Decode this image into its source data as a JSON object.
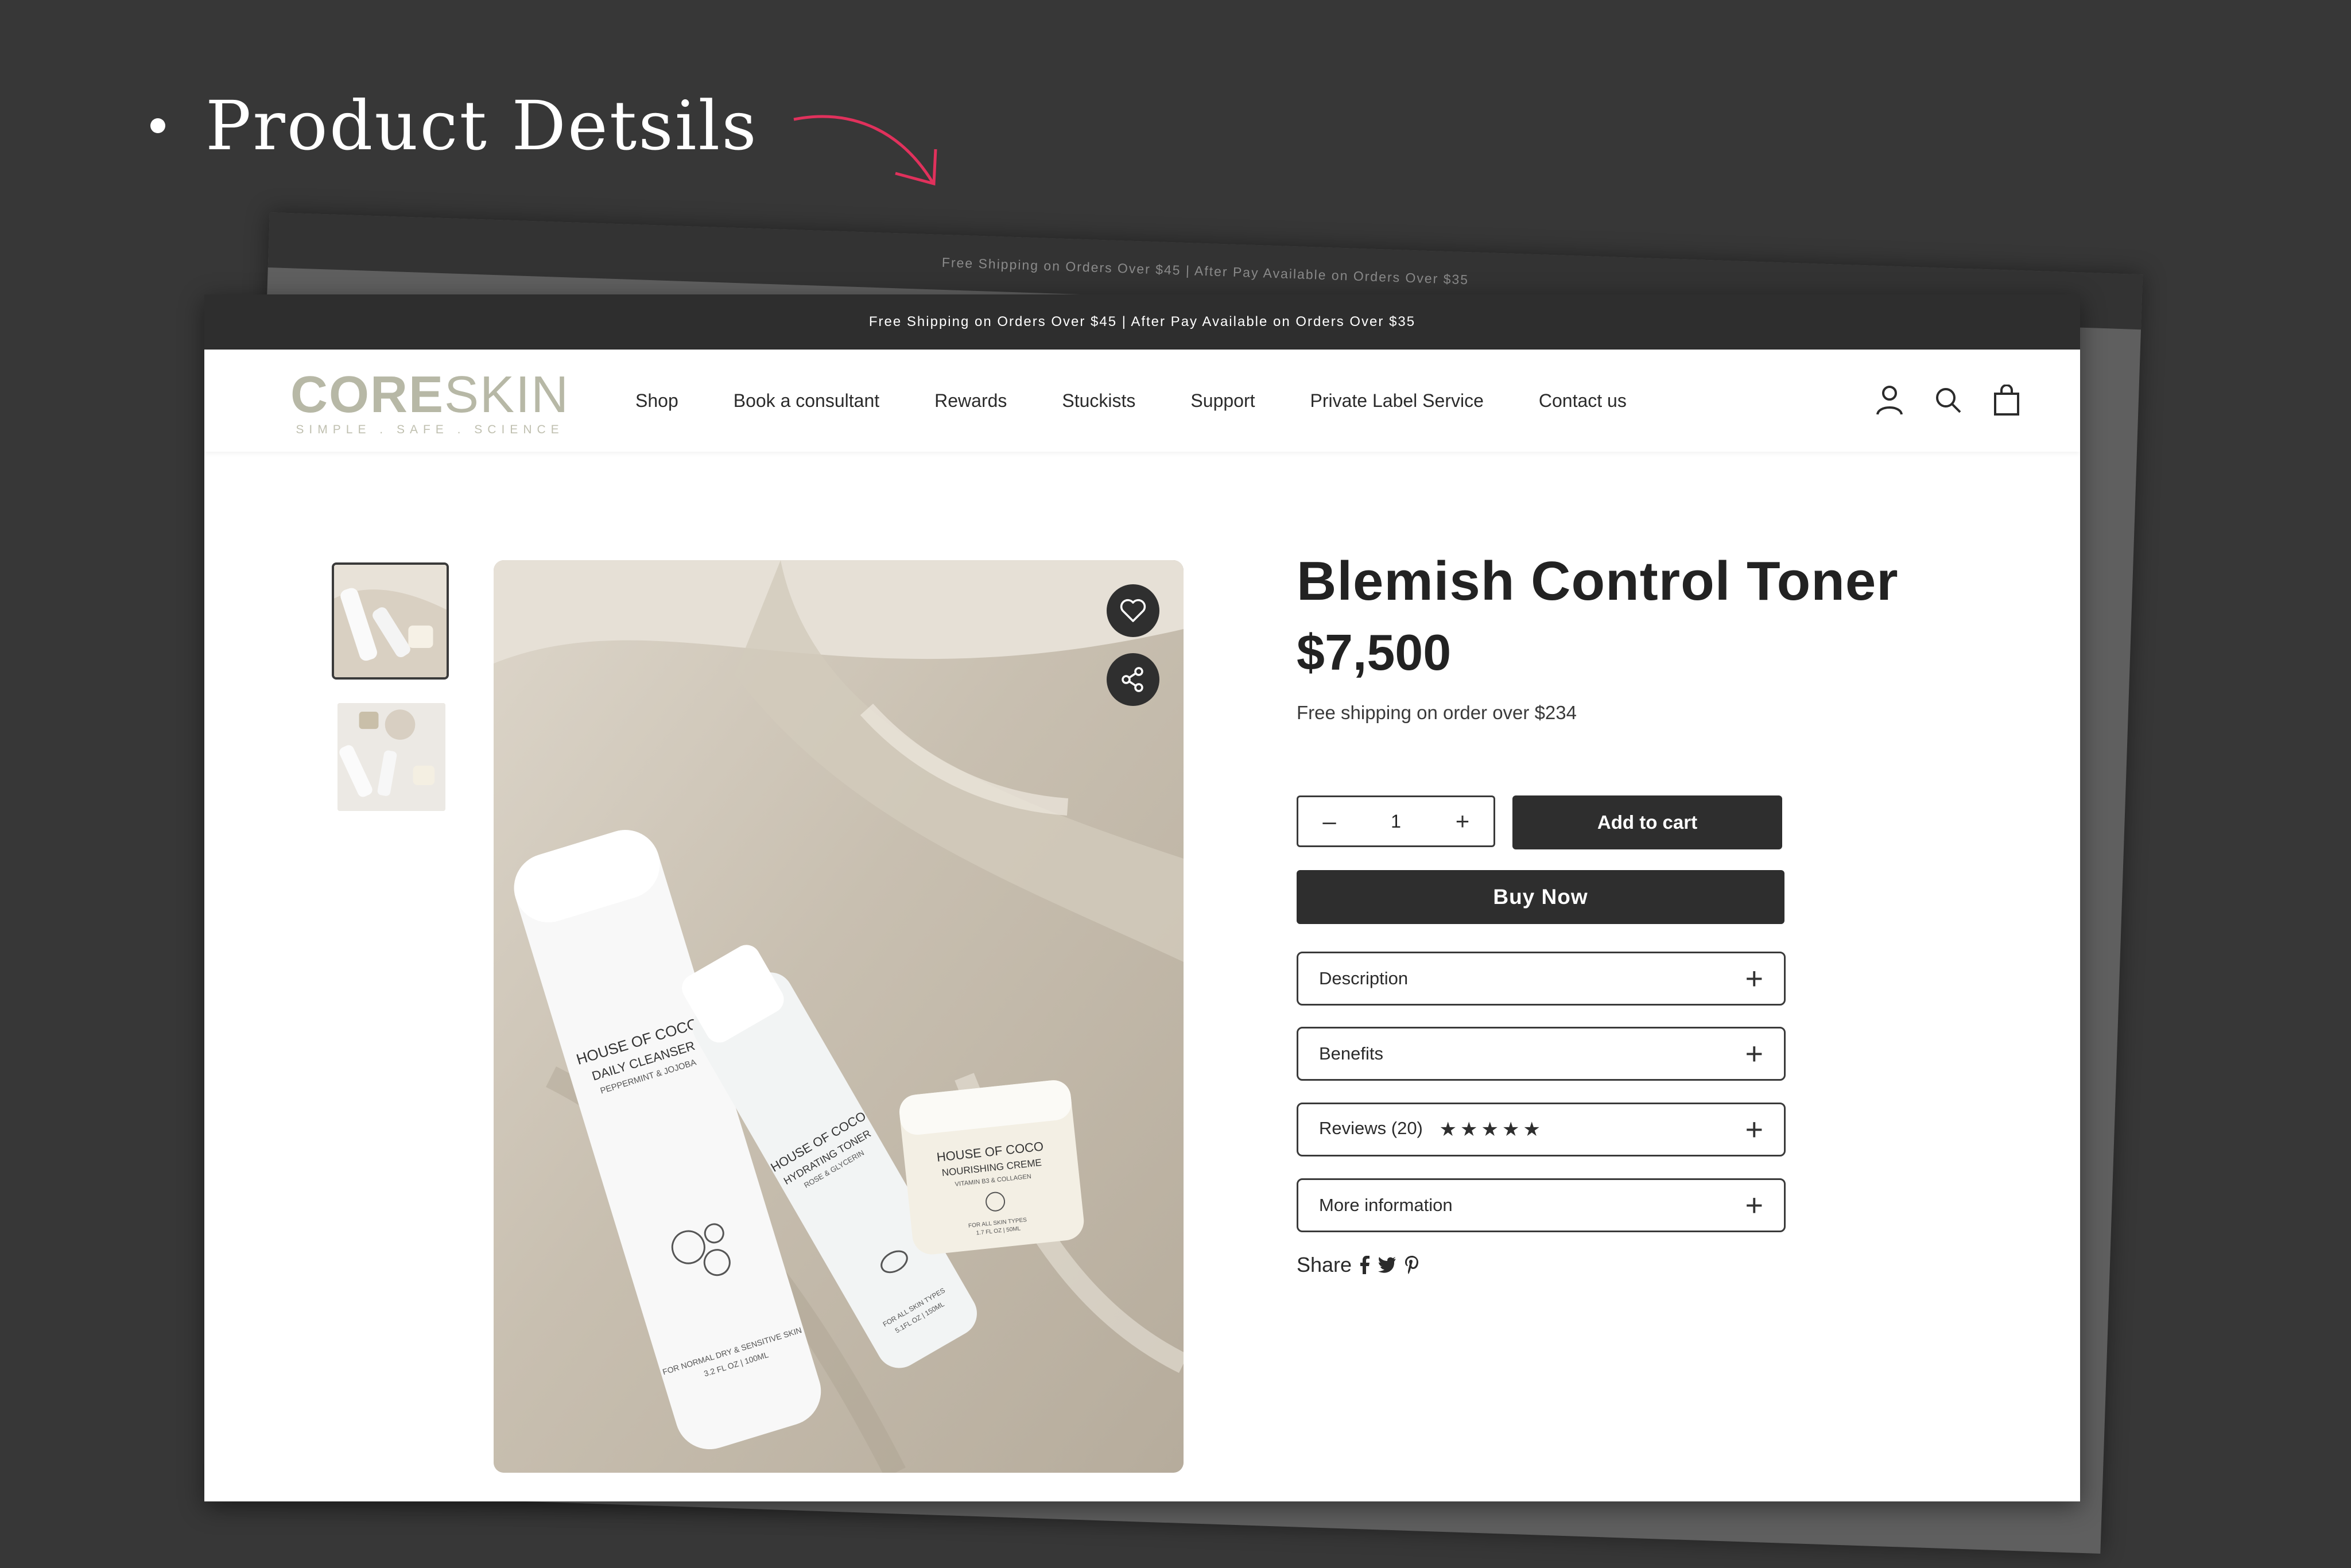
{
  "presentation": {
    "heading": "Product Detsils"
  },
  "back_page": {
    "announcement": "Free Shipping on Orders Over $45 | After Pay Available on Orders Over $35"
  },
  "announcement": "Free Shipping on Orders Over $45 | After Pay Available on Orders Over $35",
  "brand": {
    "logo_core": "CORE",
    "logo_skin": "SKIN",
    "tagline": "SIMPLE . SAFE . SCIENCE"
  },
  "nav": {
    "items": [
      "Shop",
      "Book a consultant",
      "Rewards",
      "Stuckists",
      "Support",
      "Private Label Service",
      "Contact us"
    ]
  },
  "header_icons": [
    "account-icon",
    "search-icon",
    "cart-bag-icon"
  ],
  "product": {
    "title": "Blemish Control Toner",
    "price": "$7,500",
    "shipping_note": "Free shipping on order over $234",
    "quantity": "1",
    "add_to_cart": "Add to cart",
    "buy_now": "Buy Now",
    "accordions": {
      "description": "Description",
      "benefits": "Benefits",
      "reviews": "Reviews (20)",
      "more_info": "More information"
    },
    "rating_stars": 5,
    "share_label": "Share",
    "share_icons": [
      "facebook-icon",
      "twitter-icon",
      "pinterest-icon"
    ]
  },
  "photo": {
    "products": [
      {
        "brand": "HOUSE OF COCO",
        "name": "DAILY CLEANSER",
        "sub": "PEPPERMINT & JOJOBA",
        "foot": "FOR NORMAL DRY & SENSITIVE SKIN",
        "size": "3.2 FL OZ | 100ML"
      },
      {
        "brand": "HOUSE OF COCO",
        "name": "HYDRATING TONER",
        "sub": "ROSE & GLYCERIN",
        "foot": "FOR ALL SKIN TYPES",
        "size": "5.1FL OZ | 150ML"
      },
      {
        "brand": "HOUSE OF COCO",
        "name": "NOURISHING CREME",
        "sub": "VITAMIN B3 & COLLAGEN",
        "foot": "FOR ALL SKIN TYPES",
        "size": "1.7 FL OZ | 50ML"
      }
    ]
  },
  "colors": {
    "background": "#373737",
    "accent_arrow": "#e0315c",
    "dark_button": "#2e2e2e",
    "logo": "#b7b8a6"
  }
}
